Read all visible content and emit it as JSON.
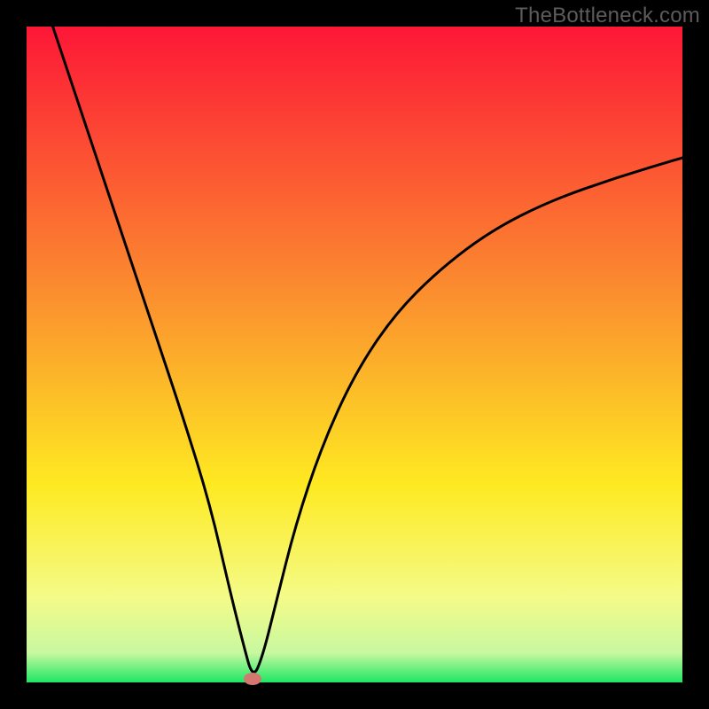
{
  "watermark": "TheBottleneck.com",
  "colors": {
    "frame_bg": "#000000",
    "gradient_top": "#fd1737",
    "gradient_mid1": "#fb8c2f",
    "gradient_mid2": "#feea22",
    "gradient_low": "#f4fb88",
    "gradient_bottom": "#1de764",
    "curve": "#000000",
    "marker": "#d4786f"
  },
  "chart_data": {
    "type": "line",
    "title": "",
    "xlabel": "",
    "ylabel": "",
    "xlim": [
      0,
      100
    ],
    "ylim": [
      0,
      100
    ],
    "annotations": [],
    "series": [
      {
        "name": "bottleneck-curve",
        "x": [
          4,
          8,
          12,
          16,
          20,
          24,
          28,
          31,
          33,
          34.5,
          36,
          38,
          41,
          45,
          50,
          56,
          63,
          71,
          80,
          90,
          100
        ],
        "y": [
          100,
          88,
          76,
          64,
          52,
          40,
          27,
          14,
          6,
          0.5,
          4,
          12,
          24,
          36,
          47,
          56,
          63,
          69,
          73.5,
          77,
          80
        ]
      }
    ],
    "marker": {
      "x": 34.5,
      "y": 0.5
    },
    "background": {
      "type": "vertical-gradient",
      "stops": [
        {
          "pos": 0.0,
          "color": "#fd1737"
        },
        {
          "pos": 0.4,
          "color": "#fb8c2f"
        },
        {
          "pos": 0.7,
          "color": "#feea22"
        },
        {
          "pos": 0.87,
          "color": "#f4fb88"
        },
        {
          "pos": 0.955,
          "color": "#c8f8a0"
        },
        {
          "pos": 1.0,
          "color": "#1de764"
        }
      ]
    }
  }
}
